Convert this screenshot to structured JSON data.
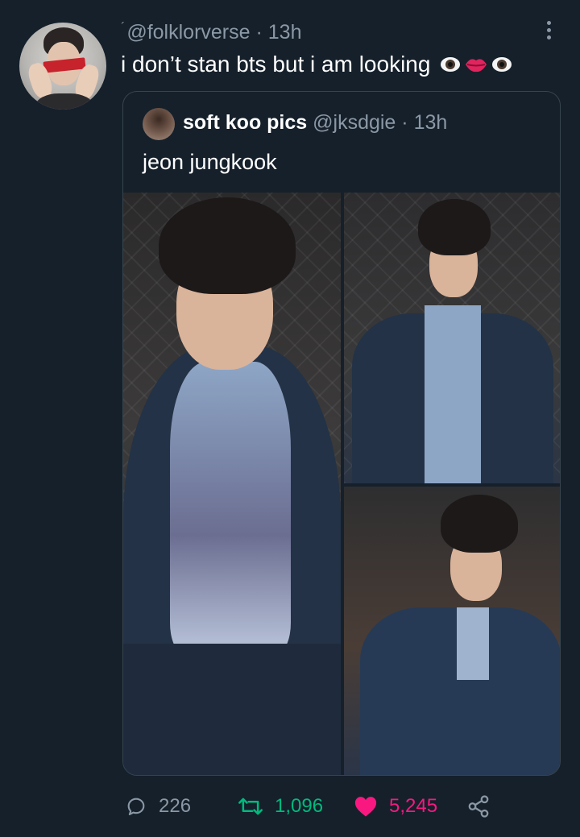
{
  "tweet": {
    "handle": "@folklorverse",
    "time": "13h",
    "text": "i don’t stan bts but i am looking",
    "emoji": [
      "eye-icon",
      "lips-icon",
      "eye-icon"
    ]
  },
  "quoted_tweet": {
    "name": "soft koo pics",
    "handle": "@jksdgie",
    "time": "13h",
    "text": "jeon jungkook",
    "media_count": 3
  },
  "actions": {
    "reply_count": "226",
    "retweet_count": "1,096",
    "like_count": "5,245"
  },
  "colors": {
    "background": "#15202b",
    "secondary_text": "#8b98a5",
    "retweet_green": "#00ba7c",
    "like_pink": "#f91880",
    "border": "#38444d"
  }
}
